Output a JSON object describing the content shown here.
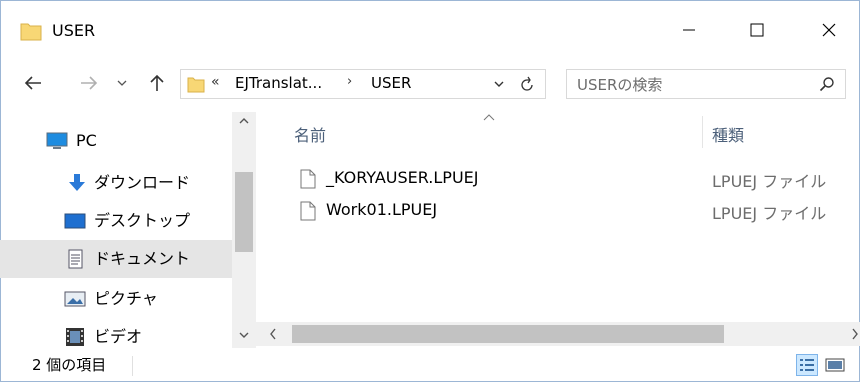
{
  "window": {
    "title": "USER",
    "icon": "folder-icon",
    "controls": [
      "minimize-icon",
      "maximize-icon",
      "close-icon"
    ]
  },
  "nav": {
    "back_icon": "back-arrow-icon",
    "forward_icon": "forward-arrow-icon",
    "recent_icon": "chevron-down-icon",
    "up_icon": "up-arrow-icon",
    "address": {
      "overflow": "«",
      "segments": [
        "EJTranslat...",
        "USER"
      ],
      "separator": "›"
    },
    "search": {
      "placeholder": "USERの検索",
      "icon": "search-icon"
    }
  },
  "sidebar": {
    "items": [
      {
        "label": "PC",
        "icon": "pc-icon"
      },
      {
        "label": "ダウンロード",
        "icon": "download-icon"
      },
      {
        "label": "デスクトップ",
        "icon": "desktop-icon"
      },
      {
        "label": "ドキュメント",
        "icon": "documents-icon",
        "selected": true
      },
      {
        "label": "ピクチャ",
        "icon": "pictures-icon"
      },
      {
        "label": "ビデオ",
        "icon": "video-icon"
      }
    ]
  },
  "content": {
    "columns": {
      "name": "名前",
      "type": "種類"
    },
    "files": [
      {
        "name": "_KORYAUSER.LPUEJ",
        "type": "LPUEJ ファイル",
        "icon": "file-icon"
      },
      {
        "name": "Work01.LPUEJ",
        "type": "LPUEJ ファイル",
        "icon": "file-icon"
      }
    ]
  },
  "status": {
    "count": "2 個の項目"
  },
  "colors": {
    "accent": "#0078d7",
    "folder": "#f8d775",
    "selected": "#e5e5e5"
  }
}
